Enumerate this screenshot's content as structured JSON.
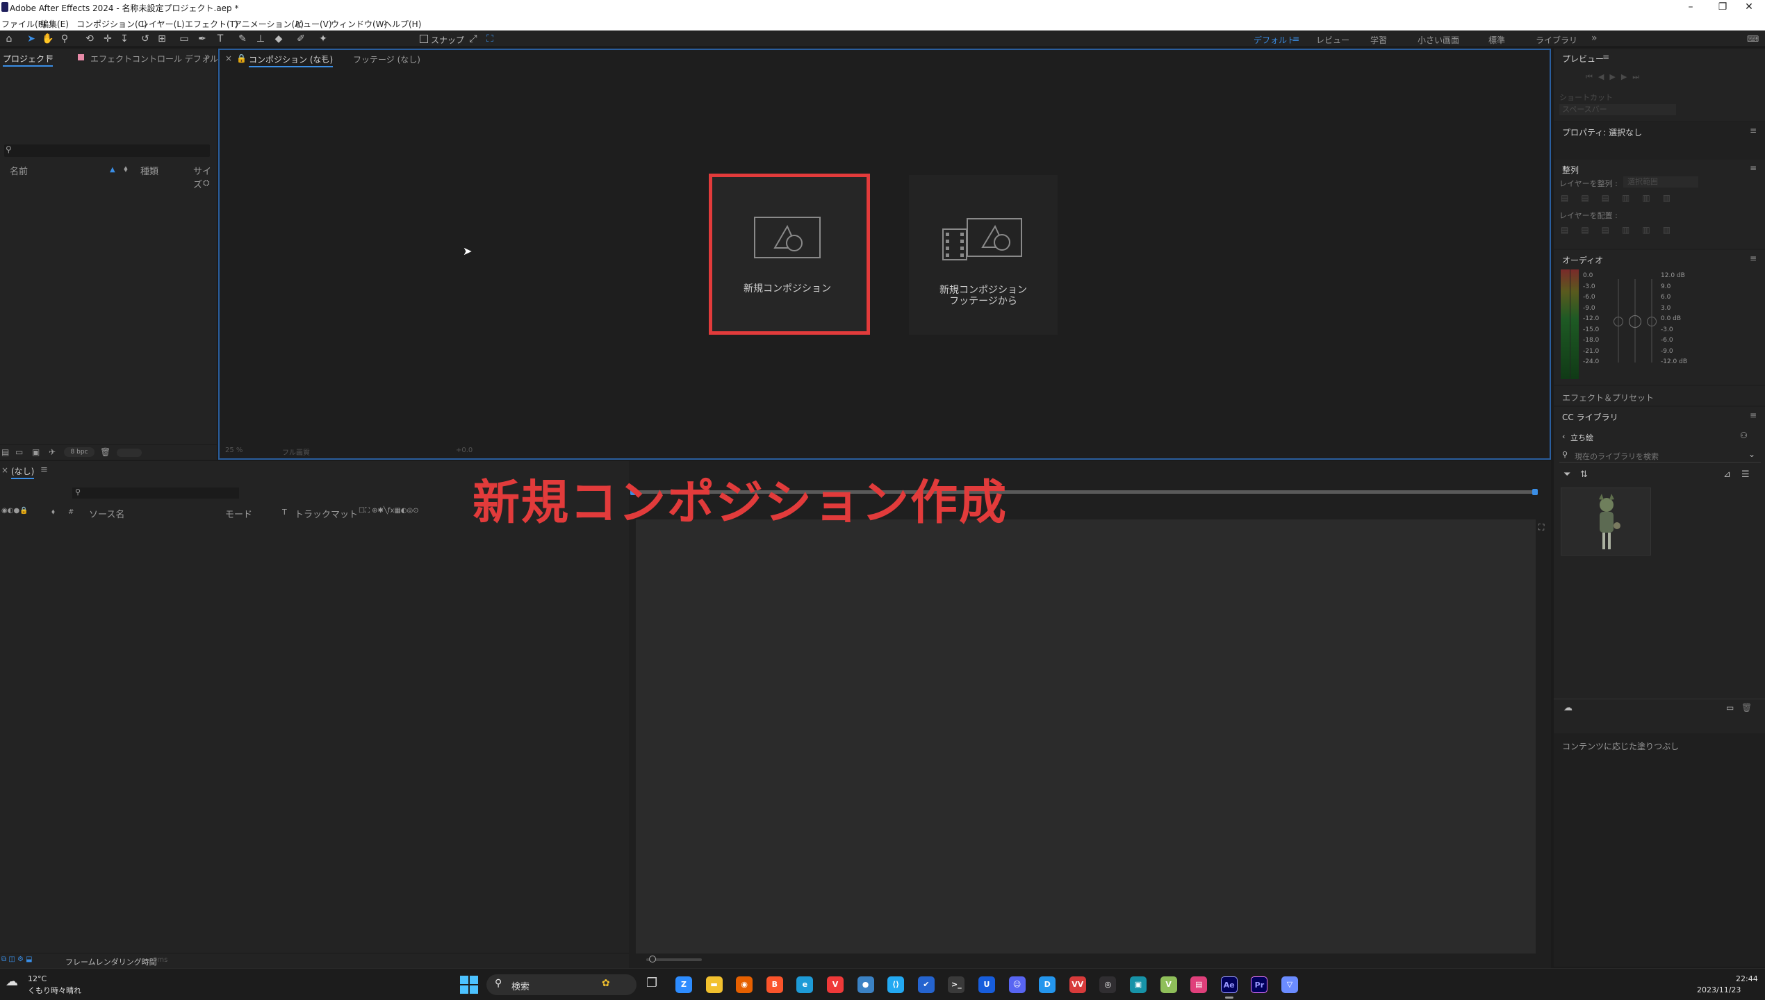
{
  "window": {
    "title": "Adobe After Effects 2024 - 名称未設定プロジェクト.aep *",
    "controls": {
      "minimize": "–",
      "maximize": "❐",
      "close": "✕"
    }
  },
  "menu": [
    "ファイル(F)",
    "編集(E)",
    "コンポジション(C)",
    "レイヤー(L)",
    "エフェクト(T)",
    "アニメーション(A)",
    "ビュー(V)",
    "ウィンドウ(W)",
    "ヘルプ(H)"
  ],
  "toolbar": {
    "snap_label": "スナップ",
    "workspaces": [
      "デフォルト",
      "レビュー",
      "学習",
      "小さい画面",
      "標準",
      "ライブラリ"
    ],
    "active_workspace": "デフォルト"
  },
  "project_panel": {
    "tab_project": "プロジェクト",
    "tab_effects": "エフェクトコントロール デフォル",
    "columns": {
      "name": "名前",
      "type": "種類",
      "size": "サイズ"
    },
    "bpc": "8 bpc"
  },
  "comp_panel": {
    "tab_comp": "コンポジション (なし)",
    "tab_footage": "フッテージ (なし)",
    "new_comp_label": "新規コンポジション",
    "new_comp_footage_line1": "新規コンポジション",
    "new_comp_footage_line2": "フッテージから",
    "footer": [
      "25 %",
      "フル画質",
      "+0.0"
    ]
  },
  "timeline": {
    "tab": "(なし)",
    "columns": {
      "source": "ソース名",
      "mode": "モード",
      "t": "T",
      "trackmatte": "トラックマット"
    },
    "footer_label": "フレームレンダリング時間",
    "footer_value": "0ms"
  },
  "overlay_caption": "新規コンポジション作成",
  "right_panels": {
    "preview": "プレビュー",
    "shortcut_label": "ショートカット",
    "shortcut_value": "スペースバー",
    "properties": "プロパティ: 選択なし",
    "align": "整列",
    "align_layers_to": "レイヤーを整列 :",
    "align_target": "選択範囲",
    "distribute_layers": "レイヤーを配置 :",
    "audio": "オーディオ",
    "audio_left_scale": [
      "0.0",
      "-3.0",
      "-6.0",
      "-9.0",
      "-12.0",
      "-15.0",
      "-18.0",
      "-21.0",
      "-24.0"
    ],
    "audio_right_scale": [
      "12.0 dB",
      "9.0",
      "6.0",
      "3.0",
      "0.0 dB",
      "-3.0",
      "-6.0",
      "-9.0",
      "-12.0 dB"
    ],
    "effects_presets": "エフェクト＆プリセット",
    "cc_libraries": "CC ライブラリ",
    "library_name": "立ち絵",
    "library_search": "現在のライブラリを検索",
    "content_aware": "コンテンツに応じた塗りつぶし"
  },
  "taskbar": {
    "weather_temp": "12°C",
    "weather_desc": "くもり時々晴れ",
    "search": "検索",
    "time": "22:44",
    "date": "2023/11/23",
    "apps": [
      {
        "name": "zoom",
        "label": "Z",
        "color": "#2d8cff"
      },
      {
        "name": "explorer",
        "label": "▬",
        "color": "#f2c12e"
      },
      {
        "name": "firefox",
        "label": "◉",
        "color": "#e66000"
      },
      {
        "name": "brave",
        "label": "B",
        "color": "#fb542b"
      },
      {
        "name": "edge",
        "label": "e",
        "color": "#1e9bd7"
      },
      {
        "name": "vivaldi",
        "label": "V",
        "color": "#ef3939"
      },
      {
        "name": "app-blue",
        "label": "●",
        "color": "#3b82c4"
      },
      {
        "name": "vscode",
        "label": "⟨⟩",
        "color": "#23a9f2"
      },
      {
        "name": "todo",
        "label": "✔",
        "color": "#2564cf"
      },
      {
        "name": "terminal",
        "label": ">_",
        "color": "#3a3a3a"
      },
      {
        "name": "bitwarden",
        "label": "U",
        "color": "#175ddc"
      },
      {
        "name": "discord",
        "label": "☺",
        "color": "#5865f2"
      },
      {
        "name": "docker",
        "label": "D",
        "color": "#2496ed"
      },
      {
        "name": "voicevox",
        "label": "VV",
        "color": "#d83b3b"
      },
      {
        "name": "obs",
        "label": "◎",
        "color": "#302e31"
      },
      {
        "name": "app-cyan",
        "label": "▣",
        "color": "#1793a8"
      },
      {
        "name": "app-green",
        "label": "V",
        "color": "#8fbf5a"
      },
      {
        "name": "app-pink",
        "label": "▤",
        "color": "#e0407b"
      },
      {
        "name": "after-effects",
        "label": "Ae",
        "color": "#00005b"
      },
      {
        "name": "premiere",
        "label": "Pr",
        "color": "#00005b"
      },
      {
        "name": "app-v",
        "label": "▽",
        "color": "#6b8cff"
      }
    ]
  },
  "colors": {
    "accent": "#3a8ee6",
    "highlight": "#e23b3b"
  }
}
